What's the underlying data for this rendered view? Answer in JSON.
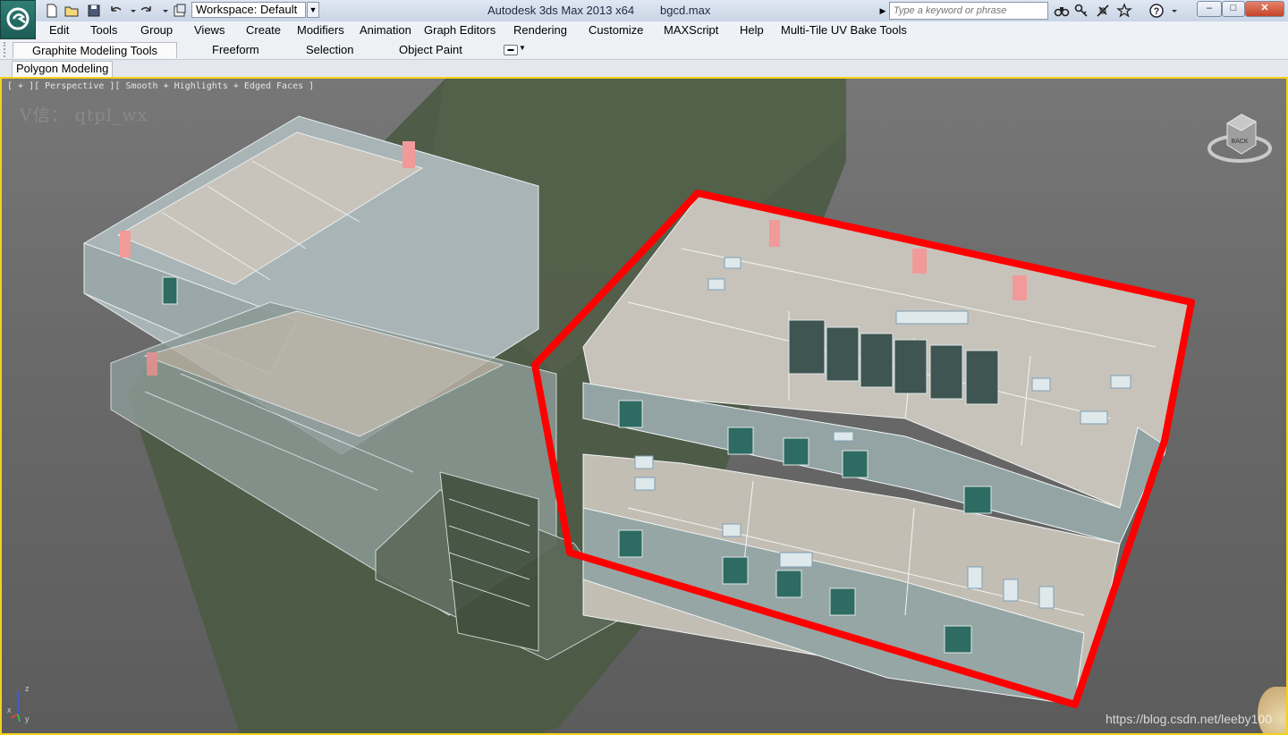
{
  "titlebar": {
    "workspace_value": "Workspace: Default",
    "app_title": "Autodesk 3ds Max  2013 x64",
    "file_name": "bgcd.max",
    "search_placeholder": "Type a keyword or phrase",
    "window_buttons": [
      "–",
      "□",
      "✕"
    ]
  },
  "menu": {
    "items": [
      "Edit",
      "Tools",
      "Group",
      "Views",
      "Create",
      "Modifiers",
      "Animation",
      "Graph Editors",
      "Rendering",
      "Customize",
      "MAXScript",
      "Help",
      "Multi-Tile UV Bake Tools"
    ]
  },
  "ribbon": {
    "tabs": [
      "Graphite Modeling Tools",
      "Freeform",
      "Selection",
      "Object Paint"
    ],
    "panel": "Polygon Modeling"
  },
  "viewport": {
    "label": "[ + ][ Perspective ][ Smooth + Highlights + Edged Faces ]",
    "overlay_text": "V信： qtpl_wx",
    "viewcube_face": "BACK",
    "highlight_color": "#ff0000",
    "border_color": "#f3d21a"
  },
  "axis": {
    "x": "x",
    "y": "y",
    "z": "z"
  },
  "csdn_watermark": "https://blog.csdn.net/leeby100"
}
